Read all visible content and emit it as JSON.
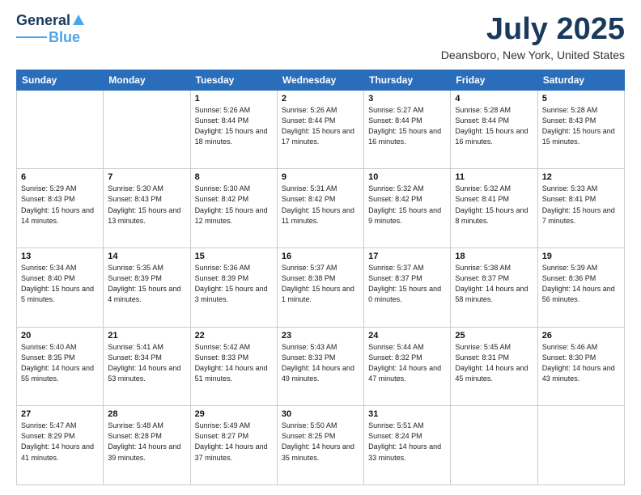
{
  "header": {
    "logo_line1": "General",
    "logo_line2": "Blue",
    "month": "July 2025",
    "location": "Deansboro, New York, United States"
  },
  "days_of_week": [
    "Sunday",
    "Monday",
    "Tuesday",
    "Wednesday",
    "Thursday",
    "Friday",
    "Saturday"
  ],
  "weeks": [
    [
      {
        "num": "",
        "info": ""
      },
      {
        "num": "",
        "info": ""
      },
      {
        "num": "1",
        "info": "Sunrise: 5:26 AM\nSunset: 8:44 PM\nDaylight: 15 hours and 18 minutes."
      },
      {
        "num": "2",
        "info": "Sunrise: 5:26 AM\nSunset: 8:44 PM\nDaylight: 15 hours and 17 minutes."
      },
      {
        "num": "3",
        "info": "Sunrise: 5:27 AM\nSunset: 8:44 PM\nDaylight: 15 hours and 16 minutes."
      },
      {
        "num": "4",
        "info": "Sunrise: 5:28 AM\nSunset: 8:44 PM\nDaylight: 15 hours and 16 minutes."
      },
      {
        "num": "5",
        "info": "Sunrise: 5:28 AM\nSunset: 8:43 PM\nDaylight: 15 hours and 15 minutes."
      }
    ],
    [
      {
        "num": "6",
        "info": "Sunrise: 5:29 AM\nSunset: 8:43 PM\nDaylight: 15 hours and 14 minutes."
      },
      {
        "num": "7",
        "info": "Sunrise: 5:30 AM\nSunset: 8:43 PM\nDaylight: 15 hours and 13 minutes."
      },
      {
        "num": "8",
        "info": "Sunrise: 5:30 AM\nSunset: 8:42 PM\nDaylight: 15 hours and 12 minutes."
      },
      {
        "num": "9",
        "info": "Sunrise: 5:31 AM\nSunset: 8:42 PM\nDaylight: 15 hours and 11 minutes."
      },
      {
        "num": "10",
        "info": "Sunrise: 5:32 AM\nSunset: 8:42 PM\nDaylight: 15 hours and 9 minutes."
      },
      {
        "num": "11",
        "info": "Sunrise: 5:32 AM\nSunset: 8:41 PM\nDaylight: 15 hours and 8 minutes."
      },
      {
        "num": "12",
        "info": "Sunrise: 5:33 AM\nSunset: 8:41 PM\nDaylight: 15 hours and 7 minutes."
      }
    ],
    [
      {
        "num": "13",
        "info": "Sunrise: 5:34 AM\nSunset: 8:40 PM\nDaylight: 15 hours and 5 minutes."
      },
      {
        "num": "14",
        "info": "Sunrise: 5:35 AM\nSunset: 8:39 PM\nDaylight: 15 hours and 4 minutes."
      },
      {
        "num": "15",
        "info": "Sunrise: 5:36 AM\nSunset: 8:39 PM\nDaylight: 15 hours and 3 minutes."
      },
      {
        "num": "16",
        "info": "Sunrise: 5:37 AM\nSunset: 8:38 PM\nDaylight: 15 hours and 1 minute."
      },
      {
        "num": "17",
        "info": "Sunrise: 5:37 AM\nSunset: 8:37 PM\nDaylight: 15 hours and 0 minutes."
      },
      {
        "num": "18",
        "info": "Sunrise: 5:38 AM\nSunset: 8:37 PM\nDaylight: 14 hours and 58 minutes."
      },
      {
        "num": "19",
        "info": "Sunrise: 5:39 AM\nSunset: 8:36 PM\nDaylight: 14 hours and 56 minutes."
      }
    ],
    [
      {
        "num": "20",
        "info": "Sunrise: 5:40 AM\nSunset: 8:35 PM\nDaylight: 14 hours and 55 minutes."
      },
      {
        "num": "21",
        "info": "Sunrise: 5:41 AM\nSunset: 8:34 PM\nDaylight: 14 hours and 53 minutes."
      },
      {
        "num": "22",
        "info": "Sunrise: 5:42 AM\nSunset: 8:33 PM\nDaylight: 14 hours and 51 minutes."
      },
      {
        "num": "23",
        "info": "Sunrise: 5:43 AM\nSunset: 8:33 PM\nDaylight: 14 hours and 49 minutes."
      },
      {
        "num": "24",
        "info": "Sunrise: 5:44 AM\nSunset: 8:32 PM\nDaylight: 14 hours and 47 minutes."
      },
      {
        "num": "25",
        "info": "Sunrise: 5:45 AM\nSunset: 8:31 PM\nDaylight: 14 hours and 45 minutes."
      },
      {
        "num": "26",
        "info": "Sunrise: 5:46 AM\nSunset: 8:30 PM\nDaylight: 14 hours and 43 minutes."
      }
    ],
    [
      {
        "num": "27",
        "info": "Sunrise: 5:47 AM\nSunset: 8:29 PM\nDaylight: 14 hours and 41 minutes."
      },
      {
        "num": "28",
        "info": "Sunrise: 5:48 AM\nSunset: 8:28 PM\nDaylight: 14 hours and 39 minutes."
      },
      {
        "num": "29",
        "info": "Sunrise: 5:49 AM\nSunset: 8:27 PM\nDaylight: 14 hours and 37 minutes."
      },
      {
        "num": "30",
        "info": "Sunrise: 5:50 AM\nSunset: 8:25 PM\nDaylight: 14 hours and 35 minutes."
      },
      {
        "num": "31",
        "info": "Sunrise: 5:51 AM\nSunset: 8:24 PM\nDaylight: 14 hours and 33 minutes."
      },
      {
        "num": "",
        "info": ""
      },
      {
        "num": "",
        "info": ""
      }
    ]
  ]
}
